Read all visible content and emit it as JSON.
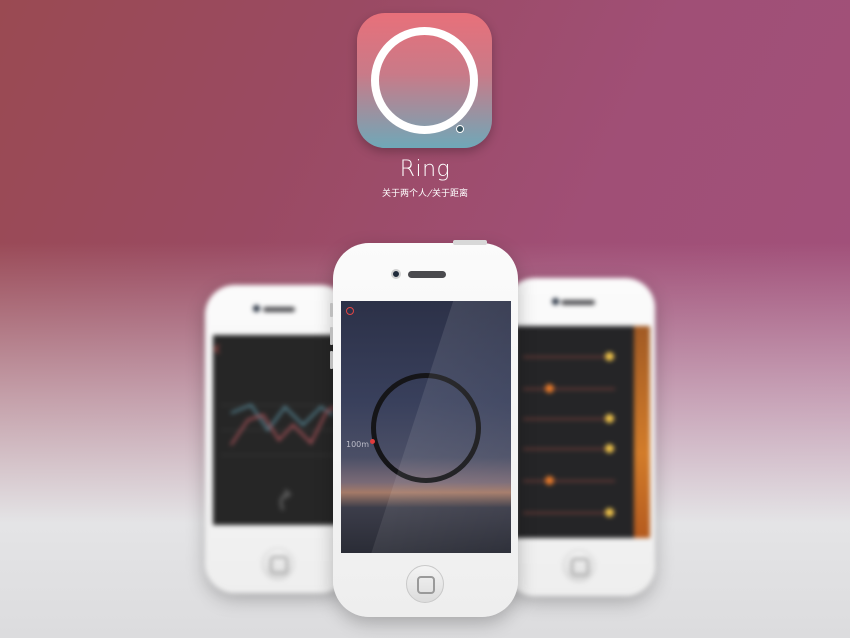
{
  "app": {
    "name": "Ring",
    "tagline_left": "关于两个人",
    "tagline_sep": "/",
    "tagline_right": "关于距离"
  },
  "center_screen": {
    "distance_label": "100m"
  },
  "colors": {
    "icon_top": "#e8707a",
    "icon_bottom": "#6fa8b8",
    "ring_marker": "#e03c3c",
    "bulb_yellow": "#f0c44a",
    "bulb_orange": "#e87a2a"
  },
  "icons": [
    "ring-logo-icon",
    "record-icon",
    "home-button-icon",
    "back-chevron-icon",
    "undo-icon"
  ]
}
